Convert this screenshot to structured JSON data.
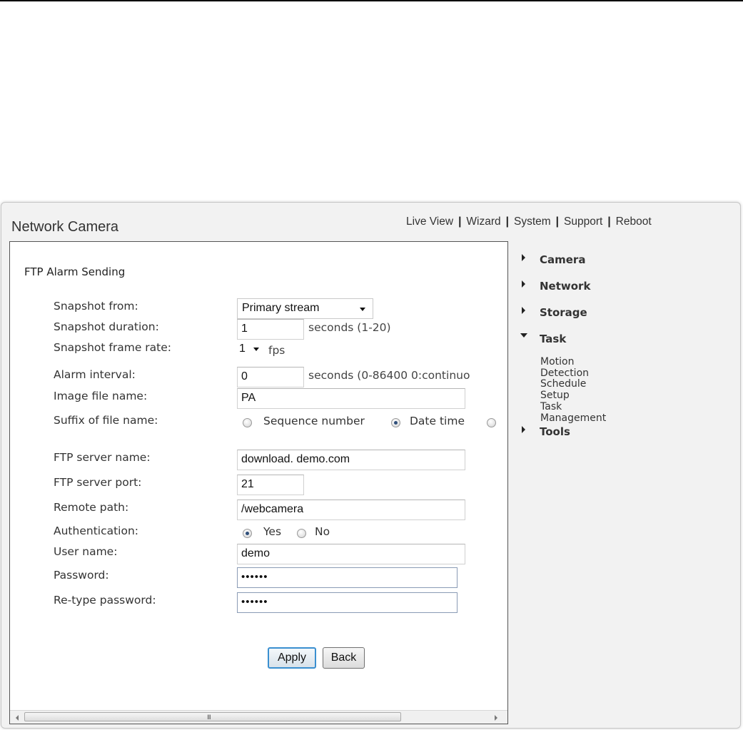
{
  "header": {
    "app_title": "Network Camera",
    "nav": [
      "Live View",
      "Wizard",
      "System",
      "Support",
      "Reboot"
    ]
  },
  "section_title": "FTP Alarm Sending",
  "form": {
    "snapshot_from": {
      "label": "Snapshot from:",
      "value": "Primary stream"
    },
    "snapshot_duration": {
      "label": "Snapshot duration:",
      "value": "1",
      "unit": "seconds (1-20)"
    },
    "snapshot_frame_rate": {
      "label": "Snapshot frame rate:",
      "value": "1",
      "unit": "fps"
    },
    "alarm_interval": {
      "label": "Alarm interval:",
      "value": "0",
      "unit": "seconds (0-86400 0:continuo"
    },
    "image_file_name": {
      "label": "Image file name:",
      "value": "PA"
    },
    "suffix": {
      "label": "Suffix of file name:",
      "options": [
        "Sequence number",
        "Date time"
      ],
      "selected": "Date time"
    },
    "ftp_server_name": {
      "label": "FTP server name:",
      "value": "download. demo.com"
    },
    "ftp_server_port": {
      "label": "FTP server port:",
      "value": "21"
    },
    "remote_path": {
      "label": "Remote path:",
      "value": "/webcamera"
    },
    "authentication": {
      "label": "Authentication:",
      "options": [
        "Yes",
        "No"
      ],
      "selected": "Yes"
    },
    "user_name": {
      "label": "User name:",
      "value": "demo"
    },
    "password": {
      "label": "Password:",
      "value": "••••••"
    },
    "retype_password": {
      "label": "Re-type password:",
      "value": "••••••"
    }
  },
  "buttons": {
    "apply": "Apply",
    "back": "Back"
  },
  "sidebar": {
    "items": [
      {
        "label": "Camera",
        "expanded": false
      },
      {
        "label": "Network",
        "expanded": false
      },
      {
        "label": "Storage",
        "expanded": false
      },
      {
        "label": "Task",
        "expanded": true,
        "children": [
          "Motion Detection",
          "Schedule Setup",
          "Task Management"
        ]
      },
      {
        "label": "Tools",
        "expanded": false
      }
    ]
  },
  "scrollbar": {
    "grip": "III"
  },
  "colors": {
    "accent": "#3a8fd0",
    "frame_bg": "#f2f2f2",
    "radio_dot": "#2f4f7a"
  }
}
